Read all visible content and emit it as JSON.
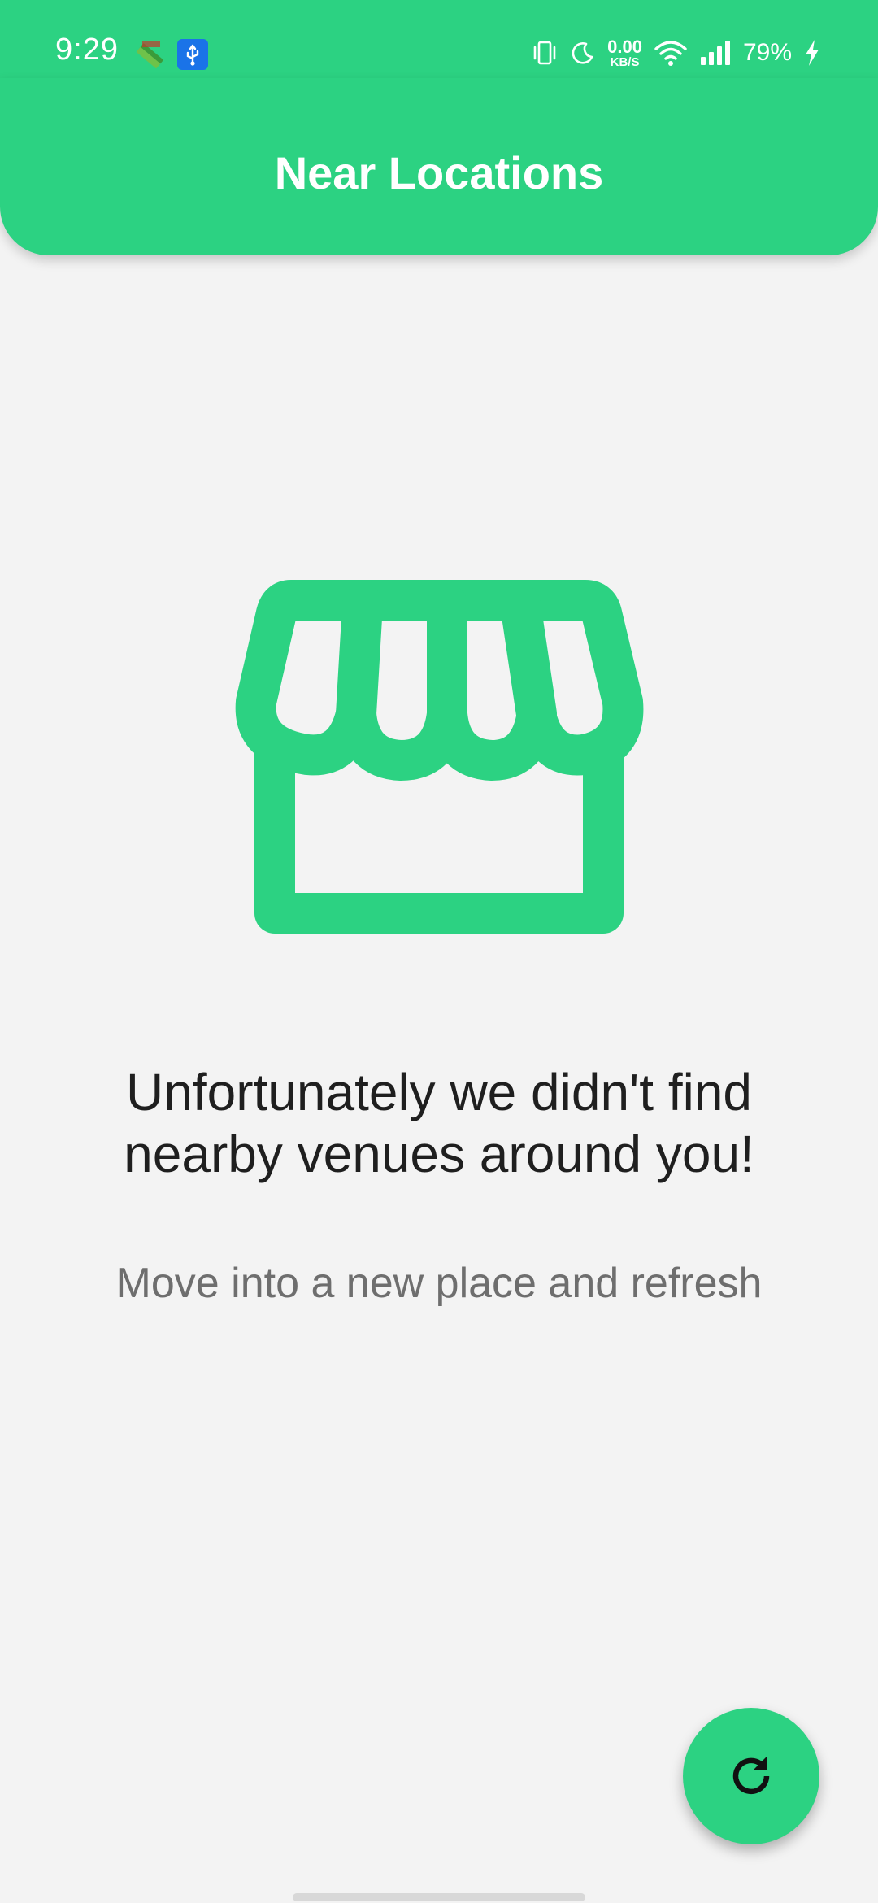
{
  "status_bar": {
    "time": "9:29",
    "net_speed_value": "0.00",
    "net_speed_unit": "KB/S",
    "battery": "79%",
    "icons": [
      "fake-gps-icon",
      "usb-icon",
      "vibrate-icon",
      "do-not-disturb-icon",
      "wifi-icon",
      "signal-icon",
      "charging-icon"
    ]
  },
  "app_bar": {
    "title": "Near Locations"
  },
  "empty_state": {
    "icon": "store-icon",
    "title": "Unfortunately we didn't find nearby venues around you!",
    "subtitle": "Move into a new place and refresh"
  },
  "fab": {
    "icon": "refresh-icon"
  },
  "colors": {
    "accent": "#2cd282",
    "background": "#f3f3f3",
    "title_text": "#1f1f1f",
    "subtitle_text": "#6e6e6e"
  }
}
